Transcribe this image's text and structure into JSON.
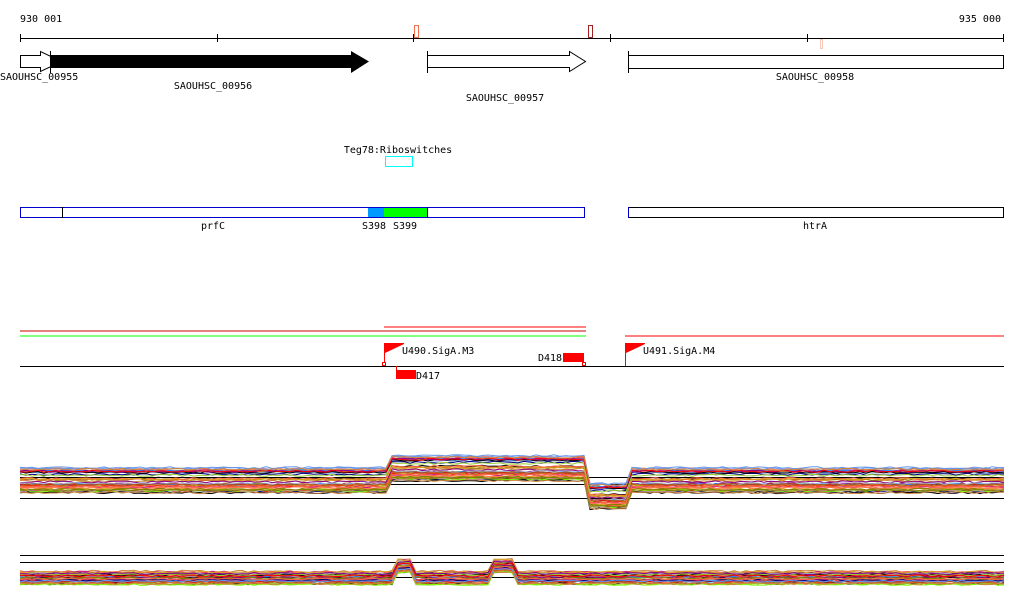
{
  "ruler": {
    "start_label": "930 001",
    "end_label": "935 000"
  },
  "genes": [
    {
      "name": "SAOUHSC_00955",
      "strand": "+",
      "fill": "none"
    },
    {
      "name": "SAOUHSC_00956",
      "strand": "+",
      "fill": "#000000"
    },
    {
      "name": "SAOUHSC_00957",
      "strand": "+",
      "fill": "none"
    },
    {
      "name": "SAOUHSC_00958",
      "strand": "none",
      "fill": "none"
    }
  ],
  "riboswitch": {
    "label": "Teg78:Riboswitches",
    "color": "#00ffff"
  },
  "operons": {
    "left_label": "prfC",
    "right_label": "htrA",
    "segments": [
      {
        "label": "S398",
        "color": "#0099ff"
      },
      {
        "label": "S399",
        "color": "#00ff00"
      }
    ],
    "outline_color": "#0000cc"
  },
  "transcription": {
    "promoters": [
      "U490.SigA.M3",
      "U491.SigA.M4"
    ],
    "terminators": [
      "D418",
      "D417"
    ],
    "colors": {
      "red": "#ff0000",
      "green": "#00ff00"
    }
  },
  "expression_palette": [
    "#808000",
    "#d2691e",
    "#000000",
    "#ff6347",
    "#6495ed",
    "#9acd32",
    "#8b008b",
    "#ff0000",
    "#cd853f",
    "#7cfc00",
    "#b0c4de",
    "#c71585",
    "#1e90ff",
    "#a0522d",
    "#000080",
    "#bc8f8f",
    "#daa520",
    "#ff7f50"
  ]
}
